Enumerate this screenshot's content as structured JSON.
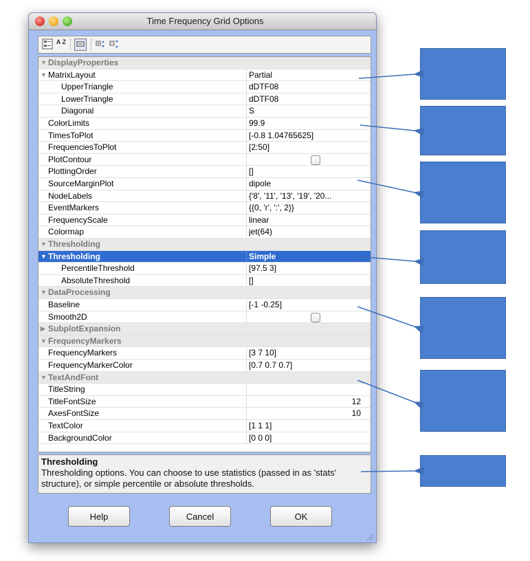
{
  "window": {
    "title": "Time Frequency Grid Options"
  },
  "toolbar": {
    "icons": [
      "categorized-view-icon",
      "sort-alphabetical-icon",
      "description-toggle-icon",
      "expand-all-icon",
      "collapse-all-icon"
    ],
    "sort_label": "A Z"
  },
  "grid": {
    "rows": [
      {
        "type": "cat",
        "expanded": true,
        "name": "DisplayProperties"
      },
      {
        "type": "prop",
        "expandable": true,
        "name": "MatrixLayout",
        "value": "Partial"
      },
      {
        "type": "prop",
        "indent": 2,
        "name": "UpperTriangle",
        "value": "dDTF08"
      },
      {
        "type": "prop",
        "indent": 2,
        "name": "LowerTriangle",
        "value": "dDTF08"
      },
      {
        "type": "prop",
        "indent": 2,
        "name": "Diagonal",
        "value": "S"
      },
      {
        "type": "prop",
        "name": "ColorLimits",
        "value": "99.9"
      },
      {
        "type": "prop",
        "name": "TimesToPlot",
        "value": "[-0.8 1.04765625]"
      },
      {
        "type": "prop",
        "name": "FrequenciesToPlot",
        "value": "[2:50]"
      },
      {
        "type": "prop",
        "name": "PlotContour",
        "checkbox": true,
        "checked": false
      },
      {
        "type": "prop",
        "name": "PlottingOrder",
        "value": "[]"
      },
      {
        "type": "prop",
        "name": "SourceMarginPlot",
        "value": "dipole"
      },
      {
        "type": "prop",
        "name": "NodeLabels",
        "value": "{'8', '11', '13', '19', '20..."
      },
      {
        "type": "prop",
        "name": "EventMarkers",
        "value": "{{0, 'r', ':', 2}}"
      },
      {
        "type": "prop",
        "name": "FrequencyScale",
        "value": "linear"
      },
      {
        "type": "prop",
        "name": "Colormap",
        "value": "jet(64)"
      },
      {
        "type": "cat",
        "expanded": true,
        "name": "Thresholding"
      },
      {
        "type": "prop",
        "expandable": true,
        "selected": true,
        "name": "Thresholding",
        "value": "Simple"
      },
      {
        "type": "prop",
        "indent": 2,
        "name": "PercentileThreshold",
        "value": "[97.5 3]"
      },
      {
        "type": "prop",
        "indent": 2,
        "name": "AbsoluteThreshold",
        "value": "[]"
      },
      {
        "type": "cat",
        "expanded": true,
        "name": "DataProcessing"
      },
      {
        "type": "prop",
        "name": "Baseline",
        "value": "[-1 -0.25]"
      },
      {
        "type": "prop",
        "name": "Smooth2D",
        "checkbox": true,
        "checked": false
      },
      {
        "type": "cat",
        "expanded": false,
        "name": "SubplotExpansion"
      },
      {
        "type": "cat",
        "expanded": true,
        "name": "FrequencyMarkers"
      },
      {
        "type": "prop",
        "name": "FrequencyMarkers",
        "value": "[3 7 10]"
      },
      {
        "type": "prop",
        "name": "FrequencyMarkerColor",
        "value": "[0.7 0.7 0.7]"
      },
      {
        "type": "cat",
        "expanded": true,
        "name": "TextAndFont"
      },
      {
        "type": "prop",
        "name": "TitleString",
        "value": ""
      },
      {
        "type": "prop",
        "name": "TitleFontSize",
        "value": "12",
        "align": "right"
      },
      {
        "type": "prop",
        "name": "AxesFontSize",
        "value": "10",
        "align": "right"
      },
      {
        "type": "prop",
        "name": "TextColor",
        "value": "[1 1 1]"
      },
      {
        "type": "prop",
        "name": "BackgroundColor",
        "value": "[0 0 0]"
      }
    ]
  },
  "description": {
    "heading": "Thresholding",
    "text": "Thresholding options.  You can choose to use statistics (passed in as 'stats' structure), or simple percentile or absolute thresholds."
  },
  "buttons": {
    "help": "Help",
    "cancel": "Cancel",
    "ok": "OK"
  },
  "colors": {
    "window_bg": "#a7bff0",
    "selection": "#2f6bd0",
    "annotation_box": "#4a7fd0",
    "annotation_arrow": "#3f6fb8"
  }
}
